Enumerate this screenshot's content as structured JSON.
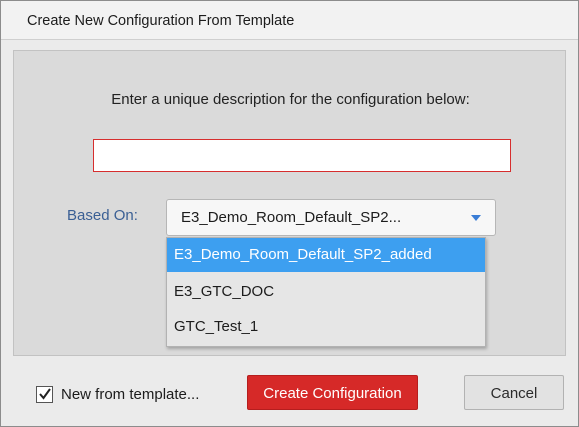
{
  "dialog": {
    "title": "Create New Configuration From Template",
    "prompt": "Enter a unique description for the configuration below:",
    "description_value": "",
    "based_on_label": "Based On:",
    "based_on_selected": "E3_Demo_Room_Default_SP2...",
    "options": [
      "E3_Demo_Room_Default_SP2_added",
      "E3_GTC_DOC",
      "GTC_Test_1"
    ],
    "selected_index": 0,
    "new_from_template_label": "New from template...",
    "new_from_template_checked": true,
    "create_label": "Create Configuration",
    "cancel_label": "Cancel",
    "colors": {
      "accent_red": "#d62928",
      "selection_blue": "#3d9ff0",
      "label_blue": "#3a5f94"
    }
  }
}
